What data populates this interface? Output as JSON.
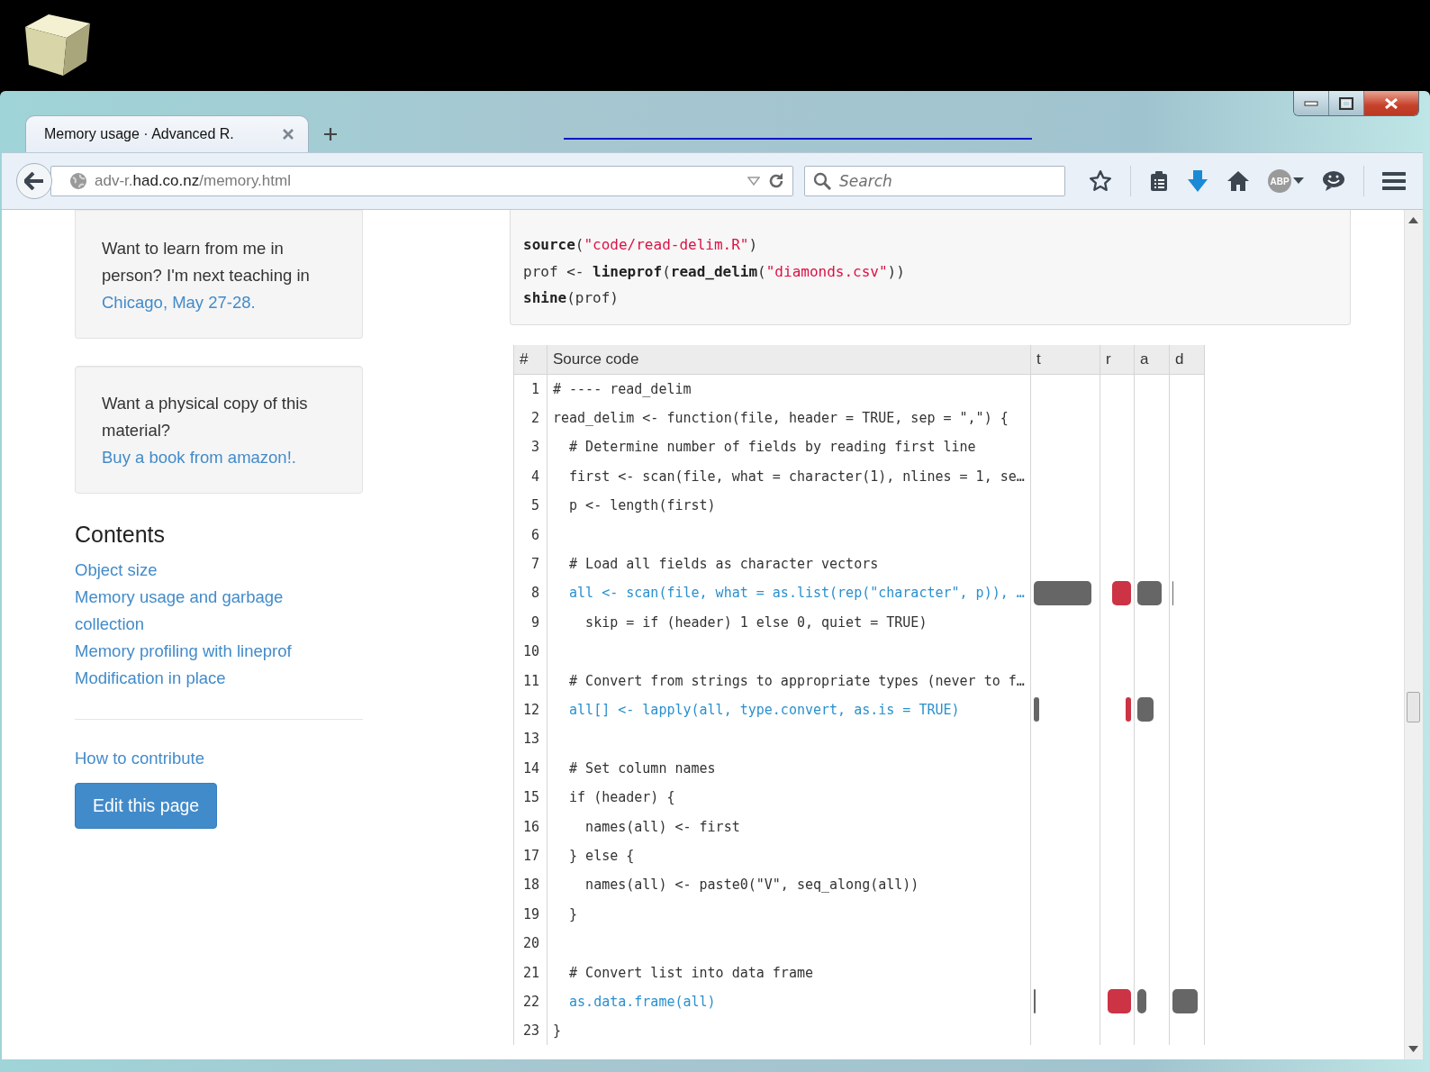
{
  "browser": {
    "tabs": [
      {
        "title": "Memory usage · Advanced R.",
        "selected": true
      }
    ],
    "address": {
      "host_prefix": "adv-r.",
      "domain": "had.co.nz",
      "path": "/memory.html"
    },
    "search": {
      "placeholder": "Search"
    },
    "adblock_label": "ABP"
  },
  "sidebar": {
    "notices": [
      {
        "text": "Want to learn from me in person? I'm next teaching in ",
        "link": "Chicago, May 27-28",
        "after": "."
      },
      {
        "text": "Want a physical copy of this material? ",
        "link": "Buy a book from amazon!",
        "after": "."
      }
    ],
    "contents_title": "Contents",
    "contents": [
      {
        "label": "Object size"
      },
      {
        "label": "Memory usage and garbage collection"
      },
      {
        "label": "Memory profiling with lineprof"
      },
      {
        "label": "Modification in place"
      }
    ],
    "contribute_link": "How to contribute",
    "edit_button": "Edit this page"
  },
  "code_block": [
    [
      {
        "kind": "fn",
        "text": "source"
      },
      {
        "kind": "plain",
        "text": "("
      },
      {
        "kind": "str",
        "text": "\"code/read-delim.R\""
      },
      {
        "kind": "plain",
        "text": ")"
      }
    ],
    [
      {
        "kind": "plain",
        "text": "prof <- "
      },
      {
        "kind": "fn",
        "text": "lineprof"
      },
      {
        "kind": "plain",
        "text": "("
      },
      {
        "kind": "fn",
        "text": "read_delim"
      },
      {
        "kind": "plain",
        "text": "("
      },
      {
        "kind": "str",
        "text": "\"diamonds.csv\""
      },
      {
        "kind": "plain",
        "text": "))"
      }
    ],
    [
      {
        "kind": "fn",
        "text": "shine"
      },
      {
        "kind": "plain",
        "text": "(prof)"
      }
    ]
  ],
  "table": {
    "columns": [
      {
        "label": "#",
        "kind": "number"
      },
      {
        "label": "Source code",
        "kind": "code"
      },
      {
        "label": "t",
        "kind": "time"
      },
      {
        "label": "r",
        "kind": "released"
      },
      {
        "label": "a",
        "kind": "allocated"
      },
      {
        "label": "d",
        "kind": "duplicated"
      }
    ],
    "rows": [
      {
        "number": "1",
        "code": "# ---- read_delim",
        "highlighted": false
      },
      {
        "number": "2",
        "code": "read_delim <- function(file, header = TRUE, sep = \",\") {",
        "highlighted": false
      },
      {
        "number": "3",
        "code": "  # Determine number of fields by reading first line",
        "highlighted": false
      },
      {
        "number": "4",
        "code": "  first <- scan(file, what = character(1), nlines = 1, se…",
        "highlighted": false
      },
      {
        "number": "5",
        "code": "  p <- length(first)",
        "highlighted": false
      },
      {
        "number": "6",
        "code": ""
      },
      {
        "number": "7",
        "code": "  # Load all fields as character vectors",
        "highlighted": false
      },
      {
        "number": "8",
        "code": "  all <- scan(file, what = as.list(rep(\"character\", p)), …",
        "highlighted": true,
        "t": {
          "level": 0.92
        },
        "r": {
          "level": 0.68
        },
        "a": {
          "level": 0.85
        },
        "d": {
          "level": 0.04
        }
      },
      {
        "number": "9",
        "code": "    skip = if (header) 1 else 0, quiet = TRUE)",
        "highlighted": false
      },
      {
        "number": "10",
        "code": ""
      },
      {
        "number": "11",
        "code": "  # Convert from strings to appropriate types (never to f…",
        "highlighted": false
      },
      {
        "number": "12",
        "code": "  all[] <- lapply(all, type.convert, as.is = TRUE)",
        "highlighted": true,
        "t": {
          "level": 0.08
        },
        "r": {
          "level": 0.2
        },
        "a": {
          "level": 0.55
        }
      },
      {
        "number": "13",
        "code": ""
      },
      {
        "number": "14",
        "code": "  # Set column names",
        "highlighted": false
      },
      {
        "number": "15",
        "code": "  if (header) {",
        "highlighted": false
      },
      {
        "number": "16",
        "code": "    names(all) <- first",
        "highlighted": false
      },
      {
        "number": "17",
        "code": "  } else {",
        "highlighted": false
      },
      {
        "number": "18",
        "code": "    names(all) <- paste0(\"V\", seq_along(all))",
        "highlighted": false
      },
      {
        "number": "19",
        "code": "  }",
        "highlighted": false
      },
      {
        "number": "20",
        "code": ""
      },
      {
        "number": "21",
        "code": "  # Convert list into data frame",
        "highlighted": false
      },
      {
        "number": "22",
        "code": "  as.data.frame(all)",
        "highlighted": true,
        "t": {
          "level": 0.03
        },
        "r": {
          "level": 0.85
        },
        "a": {
          "level": 0.3
        },
        "d": {
          "level": 0.88
        }
      },
      {
        "number": "23",
        "code": "}",
        "highlighted": false
      }
    ]
  }
}
